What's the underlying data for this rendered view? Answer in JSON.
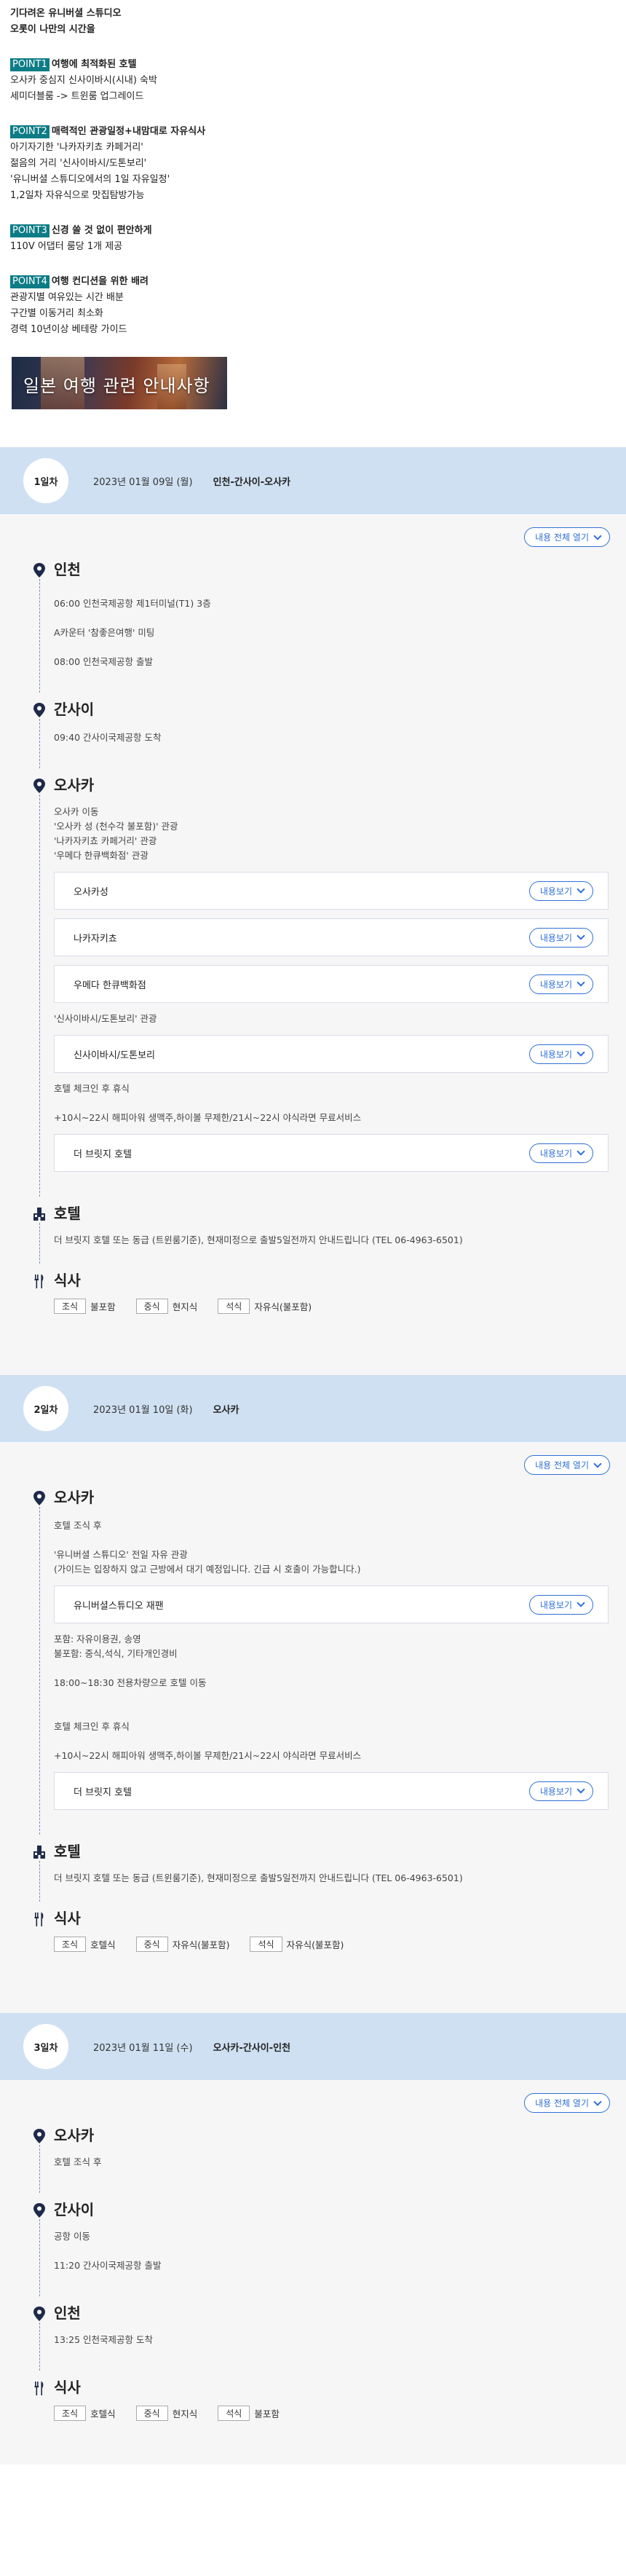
{
  "intro": {
    "title1": "기다려온 유니버셜 스튜디오",
    "title2": "오롯이 나만의 시간을",
    "points": [
      {
        "tag": "POINT1",
        "title": "여행에 최적화된 호텔",
        "lines": [
          "오사카 중심지 신사이바시(시내) 숙박",
          "세미더블룸 -> 트윈룸 업그레이드"
        ]
      },
      {
        "tag": "POINT2",
        "title": "매력적인 관광일정+내맘대로 자유식사",
        "lines": [
          "아기자기한 '나카자키쵸 카페거리'",
          "젊음의 거리 '신사이바시/도톤보리'",
          "'유니버셜 스튜디오에서의 1일 자유일정'",
          "1,2일차 자유식으로 맛집탐방가능"
        ]
      },
      {
        "tag": "POINT3",
        "title": "신경 쓸 것 없이 편안하게",
        "lines": [
          "110V 어댑터 룸당 1개 제공"
        ]
      },
      {
        "tag": "POINT4",
        "title": "여행 컨디션을 위한 배려",
        "lines": [
          "관광지별 여유있는 시간 배분",
          "구간별 이동거리 최소화",
          "경력 10년이상 베테랑 가이드"
        ]
      }
    ],
    "banner": "일본 여행 관련 안내사항"
  },
  "ui": {
    "open_all": "내용 전체 열기",
    "view": "내용보기"
  },
  "icons": {
    "location": "map-pin-icon",
    "hotel": "hotel-icon",
    "meal": "utensils-icon",
    "chevron": "chevron-down-icon"
  },
  "colors": {
    "accent": "#2f6fd6",
    "day_header": "#cfe0f2",
    "point_tag": "#0d7c86"
  },
  "days": [
    {
      "label": "1일차",
      "date": "2023년 01월 09일 (월)",
      "route": "인천-간사이-오사카",
      "incheon": {
        "title": "인천",
        "lines": [
          "06:00 인천국제공항 제1터미널(T1) 3층",
          "A카운터 '참좋은여행' 미팅",
          "08:00 인천국제공항 출발"
        ]
      },
      "kansai": {
        "title": "간사이",
        "lines": [
          "09:40 간사이국제공항 도착"
        ]
      },
      "osaka": {
        "title": "오사카",
        "intro": [
          "오사카 이동",
          "'오사카 성 (천수각 불포함)' 관광",
          "'나카자키쵸 카페거리' 관광",
          "'우메다 한큐백화점' 관광"
        ],
        "cards1": [
          "오사카성",
          "나카자키쵸",
          "우메다 한큐백화점"
        ],
        "mid": "'신사이바시/도톤보리' 관광",
        "card2": "신사이바시/도톤보리",
        "check": "호텔 체크인 후 휴식",
        "service": "+10시~22시 해피아워 생맥주,하이볼 무제한/21시~22시 야식라면 무료서비스",
        "card3": "더 브릿지 호텔"
      },
      "hotel": {
        "title": "호텔",
        "text": "더 브릿지 호텔 또는 동급 (트윈룸기준), 현재미정으로 출발5일전까지 안내드립니다 (TEL 06-4963-6501)"
      },
      "meal": {
        "title": "식사",
        "breakfast_label": "조식",
        "breakfast": "불포함",
        "lunch_label": "중식",
        "lunch": "현지식",
        "dinner_label": "석식",
        "dinner": "자유식(불포함)"
      }
    },
    {
      "label": "2일차",
      "date": "2023년 01월 10일 (화)",
      "route": "오사카",
      "osaka": {
        "title": "오사카",
        "intro": [
          "호텔 조식 후"
        ],
        "usj_lines": [
          "'유니버셜 스튜디오' 전일 자유 관광",
          "(가이드는 입장하지 않고 근방에서 대기 예정입니다. 긴급 시 호출이 가능합니다.)"
        ],
        "card_usj": "유니버셜스튜디오 재팬",
        "incl": [
          "포함: 자유이용권, 송영",
          "불포함: 중식,석식, 기타개인경비"
        ],
        "transfer": "18:00~18:30 전용차량으로 호텔 이동",
        "check": "호텔 체크인 후 휴식",
        "service": "+10시~22시 해피아워 생맥주,하이볼 무제한/21시~22시 야식라면 무료서비스",
        "card_hotel": "더 브릿지 호텔"
      },
      "hotel": {
        "title": "호텔",
        "text": "더 브릿지 호텔 또는 동급 (트윈룸기준), 현재미정으로 출발5일전까지 안내드립니다 (TEL 06-4963-6501)"
      },
      "meal": {
        "title": "식사",
        "breakfast_label": "조식",
        "breakfast": "호텔식",
        "lunch_label": "중식",
        "lunch": "자유식(불포함)",
        "dinner_label": "석식",
        "dinner": "자유식(불포함)"
      }
    },
    {
      "label": "3일차",
      "date": "2023년 01월 11일 (수)",
      "route": "오사카-간사이-인천",
      "osaka": {
        "title": "오사카",
        "lines": [
          "호텔 조식 후"
        ]
      },
      "kansai": {
        "title": "간사이",
        "lines": [
          "공항 이동",
          "11:20 간사이국제공항 출발"
        ]
      },
      "incheon": {
        "title": "인천",
        "lines": [
          "13:25 인천국제공항 도착"
        ]
      },
      "meal": {
        "title": "식사",
        "breakfast_label": "조식",
        "breakfast": "호텔식",
        "lunch_label": "중식",
        "lunch": "현지식",
        "dinner_label": "석식",
        "dinner": "불포함"
      }
    }
  ]
}
